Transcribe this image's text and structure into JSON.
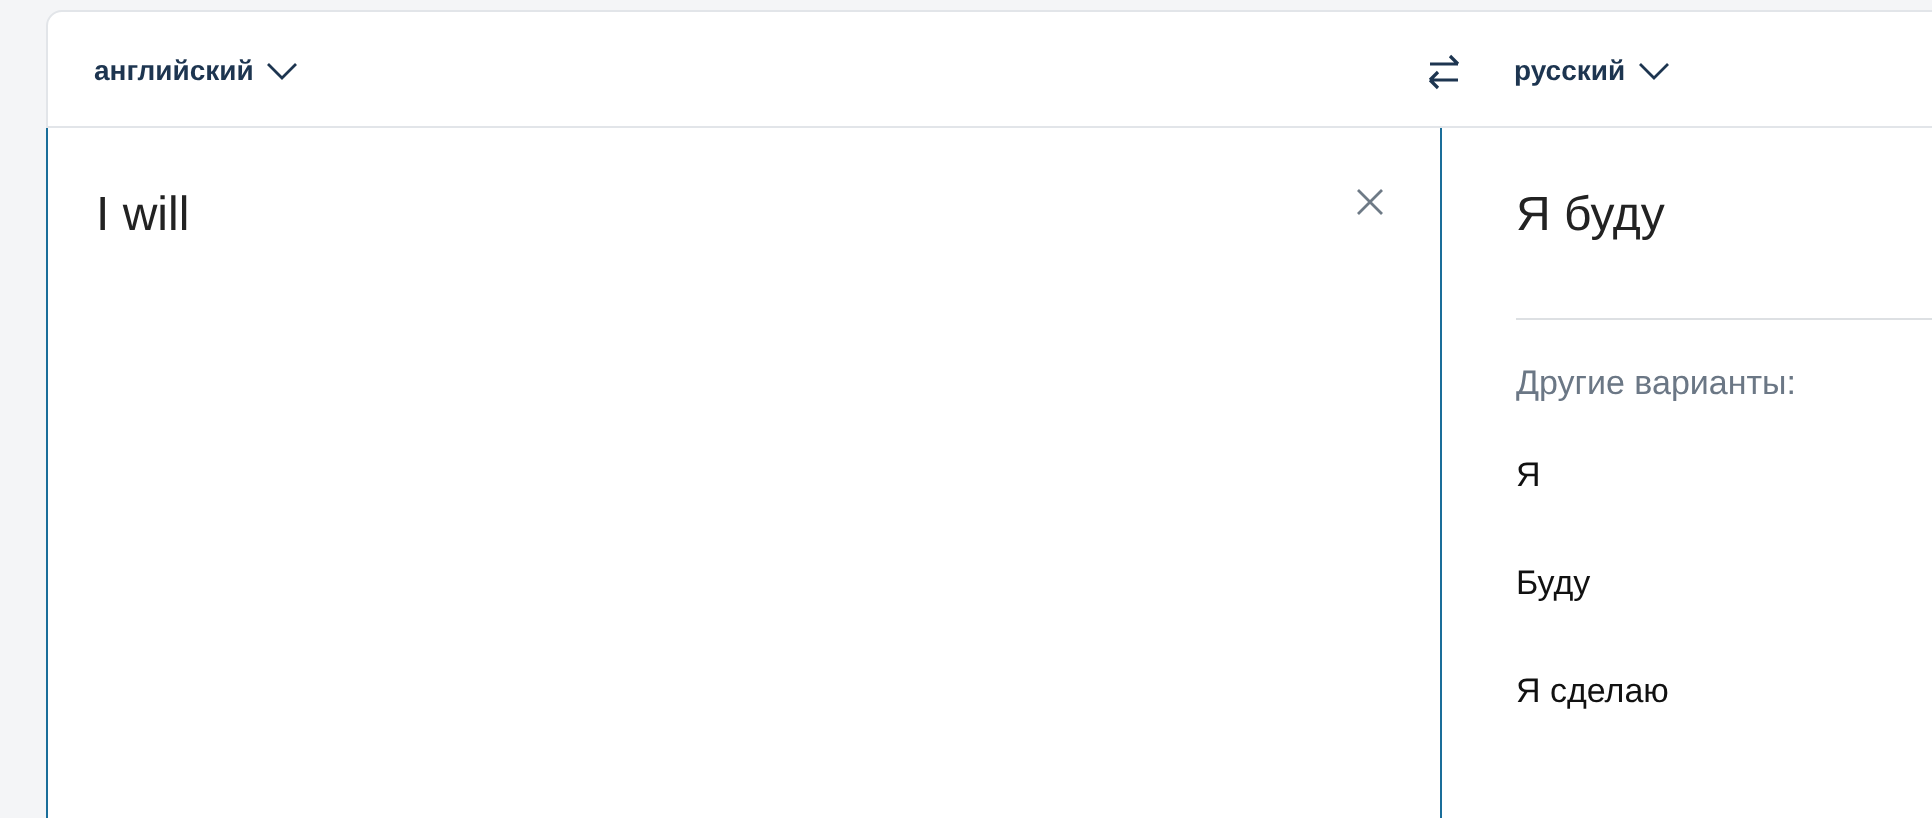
{
  "source_language": {
    "label": "английский"
  },
  "target_language": {
    "label": "русский"
  },
  "source": {
    "value": "I will"
  },
  "translation": {
    "text": "Я буду"
  },
  "alternatives": {
    "heading": "Другие варианты:",
    "items": [
      {
        "text": "Я"
      },
      {
        "text": "Буду"
      },
      {
        "text": "Я сделаю"
      }
    ]
  }
}
